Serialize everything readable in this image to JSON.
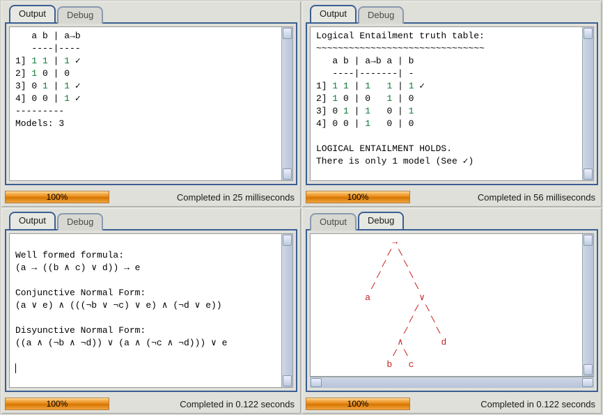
{
  "tabs": {
    "output": "Output",
    "debug": "Debug"
  },
  "panes": [
    {
      "active": "output",
      "content_html": "   a b | a→b\n   ----|----\n1] <span class='g'>1</span> <span class='g'>1</span> | <span class='g'>1</span> ✓\n2] <span class='g'>1</span> 0 | 0\n3] 0 <span class='g'>1</span> | <span class='g'>1</span> ✓\n4] 0 0 | <span class='g'>1</span> ✓\n---------\nModels: 3",
      "progress": "100%",
      "status": "Completed in 25 milliseconds",
      "hscroll": false
    },
    {
      "active": "output",
      "content_html": "Logical Entailment truth table:\n~~~~~~~~~~~~~~~~~~~~~~~~~~~~~~~\n   a b | a→b a | b\n   ----|-------| -\n1] <span class='g'>1</span> <span class='g'>1</span> | <span class='g'>1</span>   <span class='g'>1</span> | <span class='g'>1</span> ✓\n2] <span class='g'>1</span> 0 | 0   <span class='g'>1</span> | 0\n3] 0 <span class='g'>1</span> | <span class='g'>1</span>   0 | <span class='g'>1</span>\n4] 0 0 | <span class='g'>1</span>   0 | 0\n\nLOGICAL ENTAILMENT HOLDS.\nThere is only 1 model (See ✓)",
      "progress": "100%",
      "status": "Completed in 56 milliseconds",
      "hscroll": false
    },
    {
      "active": "output",
      "content_html": "\nWell formed formula:\n(a → ((b ∧ c) ∨ d)) → e\n\nConjunctive Normal Form:\n(a ∨ e) ∧ (((¬b ∨ ¬c) ∨ e) ∧ (¬d ∨ e))\n\nDisyunctive Normal Form:\n((a ∧ (¬b ∧ ¬d)) ∨ (a ∧ (¬c ∧ ¬d))) ∨ e\n\n<span class='cursor-line'></span>",
      "progress": "100%",
      "status": "Completed in 0.122 seconds",
      "hscroll": false
    },
    {
      "active": "debug",
      "content_html": "              →\n             / \\\n            /   \\\n           /     \\\n          /       \\\n         a         ∨\n                  / \\\n                 /   \\\n                /     \\\n               ∧       d\n              / \\\n             b   c",
      "progress": "100%",
      "status": "Completed in 0.122 seconds",
      "hscroll": true,
      "is_debug_tree": true
    }
  ]
}
